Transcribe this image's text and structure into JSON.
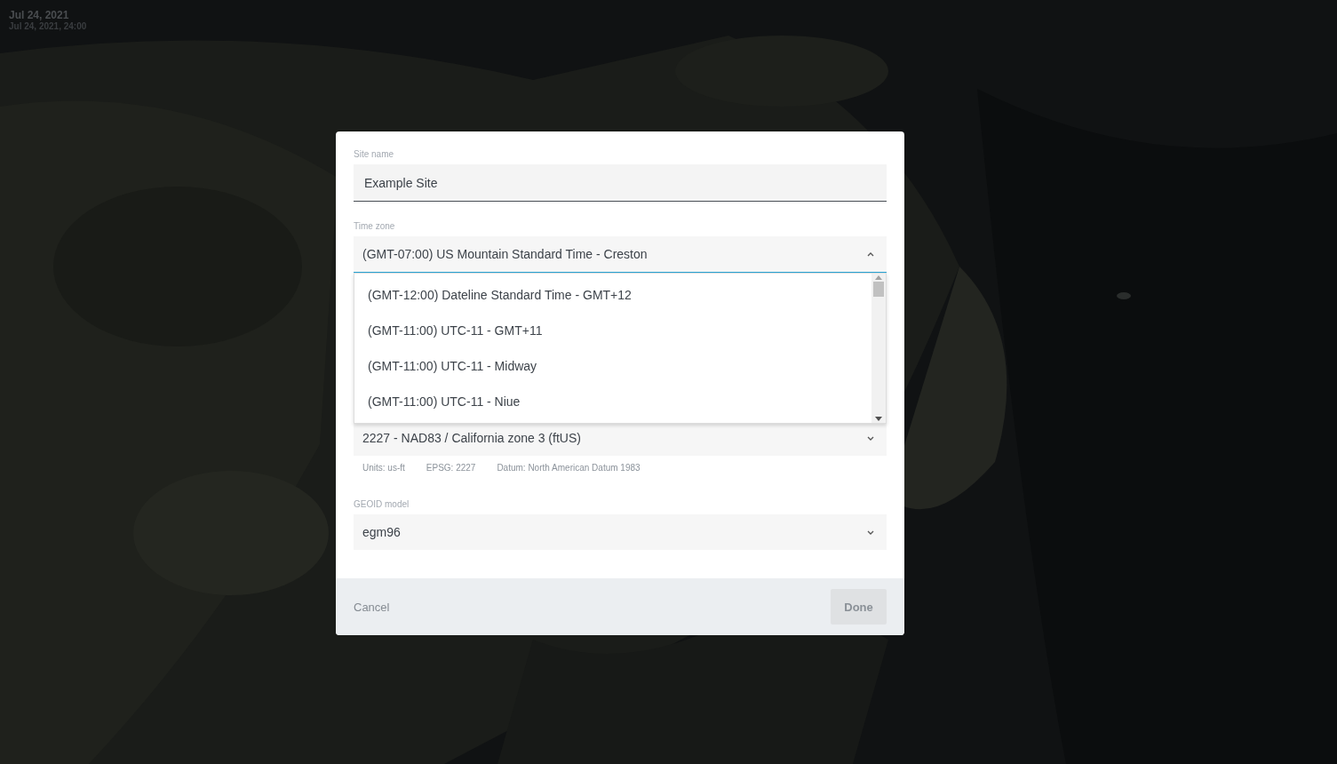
{
  "map_overlay": {
    "date": "Jul 24, 2021",
    "datetime": "Jul 24, 2021, 24:00"
  },
  "dialog": {
    "site_name": {
      "label": "Site name",
      "value": "Example Site"
    },
    "time_zone": {
      "label": "Time zone",
      "value": "(GMT-07:00) US Mountain Standard Time - Creston",
      "expanded": true,
      "options": [
        {
          "label": "(GMT-12:00) Dateline Standard Time - GMT+12",
          "selected": false
        },
        {
          "label": "(GMT-11:00) UTC-11 - GMT+11",
          "selected": false
        },
        {
          "label": "(GMT-11:00) UTC-11 - Midway",
          "selected": false
        },
        {
          "label": "(GMT-11:00) UTC-11 - Niue",
          "selected": false
        }
      ]
    },
    "coordinate_system": {
      "value": "2227 - NAD83 / California zone 3 (ftUS)",
      "details": [
        "Units: us-ft",
        "EPSG: 2227",
        "Datum: North American Datum 1983"
      ]
    },
    "geoid_model": {
      "label": "GEOID model",
      "value": "egm96"
    },
    "buttons": {
      "cancel": "Cancel",
      "done": {
        "label": "Done",
        "disabled": true
      }
    }
  }
}
